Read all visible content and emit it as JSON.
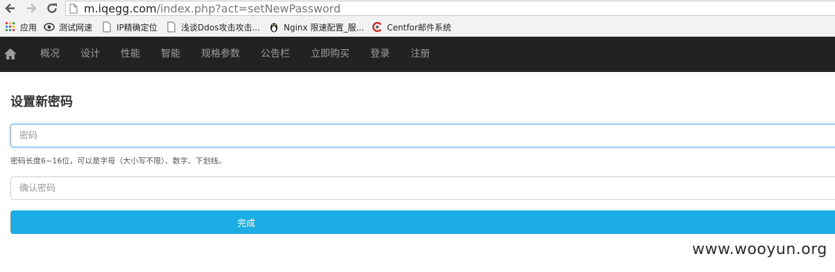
{
  "browser": {
    "url_host": "m.iqegg.com",
    "url_path": "/index.php?act=setNewPassword",
    "bookmarks": [
      {
        "label": "应用",
        "icon": "apps-grid-icon"
      },
      {
        "label": "测试网速",
        "icon": "eye-icon"
      },
      {
        "label": "IP精确定位",
        "icon": "page-icon"
      },
      {
        "label": "浅谈Ddos攻击攻击...",
        "icon": "page-icon"
      },
      {
        "label": "Nginx 限速配置_服...",
        "icon": "penguin-icon"
      },
      {
        "label": "Centfor邮件系统",
        "icon": "centfor-logo-icon"
      }
    ]
  },
  "navbar": {
    "items": [
      "概况",
      "设计",
      "性能",
      "智能",
      "规格参数",
      "公告栏",
      "立即购买",
      "登录",
      "注册"
    ],
    "bg_color": "#222222",
    "text_color": "#9d9d9d"
  },
  "form": {
    "title": "设置新密码",
    "password_placeholder": "密码",
    "help_text": "密码长度6~16位，可以是字母（大小写不限）、数字、下划线。",
    "confirm_placeholder": "确认密码",
    "submit_label": "完成",
    "submit_color": "#1bade3"
  },
  "watermark": "www.wooyun.org"
}
